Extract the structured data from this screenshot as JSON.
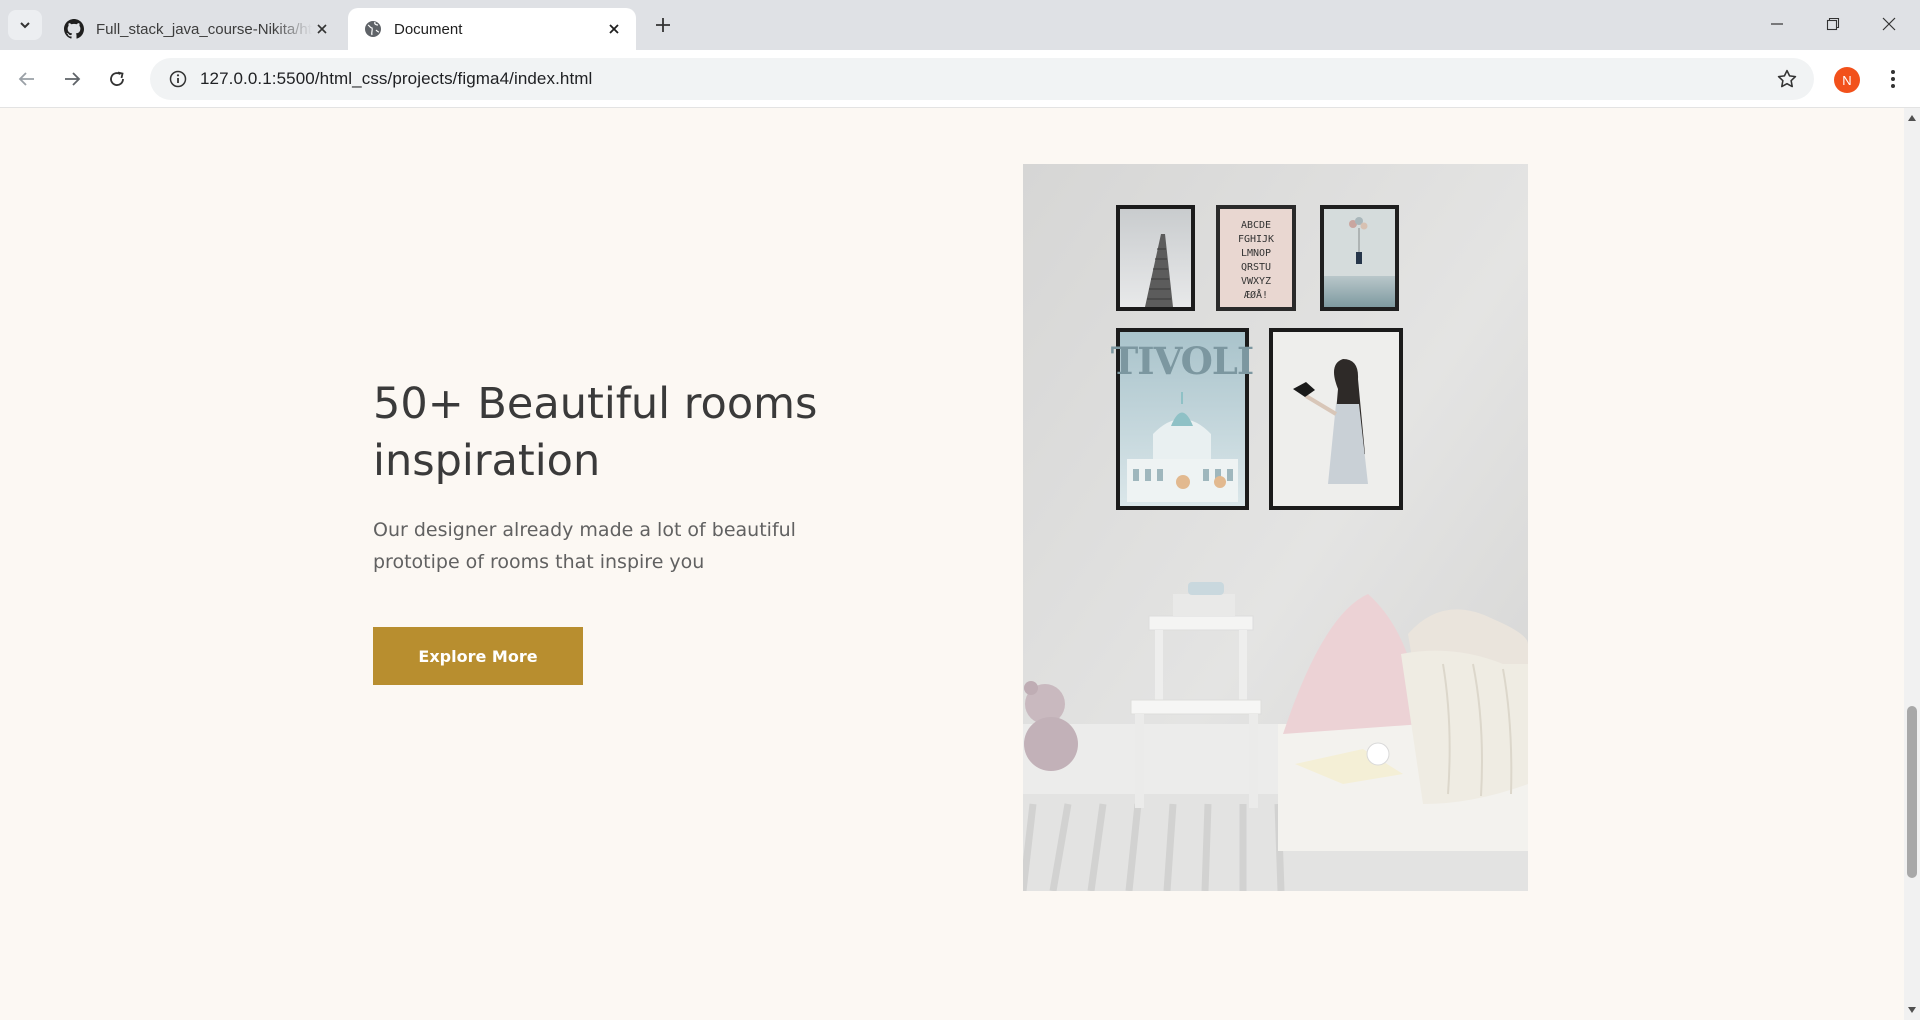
{
  "browser": {
    "tabs": [
      {
        "title": "Full_stack_java_course-Nikita/ht",
        "icon": "github-icon",
        "active": false
      },
      {
        "title": "Document",
        "icon": "globe-icon",
        "active": true
      }
    ],
    "url": "127.0.0.1:5500/html_css/projects/figma4/index.html",
    "profile_initial": "N"
  },
  "hero": {
    "title": "50+ Beautiful rooms inspiration",
    "description": "Our designer already made a lot of beautiful prototipe of rooms that inspire you",
    "button_label": "Explore More",
    "accent_color": "#b88e2f",
    "background_color": "#fcf8f3"
  },
  "photo": {
    "poster_text": "TIVOLI",
    "alphabet_rows": [
      "ABCDE",
      "FGHIJK",
      "LMNOP",
      "QRSTU",
      "VWXYZ",
      "ÆØÅ!"
    ]
  }
}
